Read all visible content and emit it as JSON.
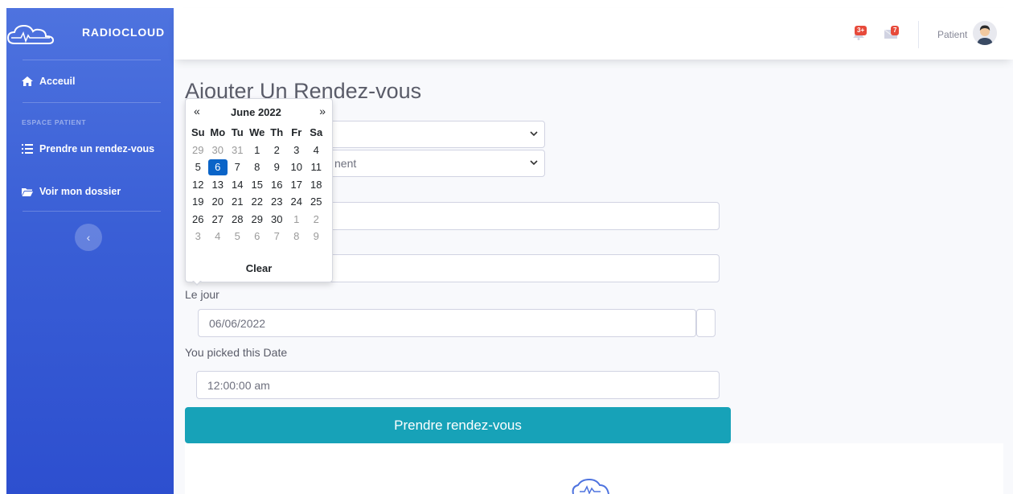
{
  "brand": {
    "name": "RADIOCLOUD",
    "logo_icon": "cloud-heartbeat-icon"
  },
  "sidebar": {
    "items": [
      {
        "label": "Acceuil",
        "icon": "home-icon"
      },
      {
        "label": "Prendre un rendez-vous",
        "icon": "list-icon"
      },
      {
        "label": "Voir mon dossier",
        "icon": "folder-icon"
      }
    ],
    "heading": "ESPACE PATIENT",
    "toggle_icon": "chevron-left-icon"
  },
  "topbar": {
    "alerts_count": "3+",
    "messages_count": "7",
    "user_name": "Patient"
  },
  "page": {
    "title": "Ajouter Un Rendez-vous",
    "select2_partial": "nent",
    "day_label": "Le jour",
    "date_value": "06/06/2022",
    "picked_label": "You picked this Date",
    "time_value": "12:00:00 am",
    "submit_label": "Prendre rendez-vous"
  },
  "datepicker": {
    "prev": "«",
    "next": "»",
    "month": "June 2022",
    "weekdays": [
      "Su",
      "Mo",
      "Tu",
      "We",
      "Th",
      "Fr",
      "Sa"
    ],
    "weeks": [
      [
        "29",
        "30",
        "31",
        "1",
        "2",
        "3",
        "4"
      ],
      [
        "5",
        "6",
        "7",
        "8",
        "9",
        "10",
        "11"
      ],
      [
        "12",
        "13",
        "14",
        "15",
        "16",
        "17",
        "18"
      ],
      [
        "19",
        "20",
        "21",
        "22",
        "23",
        "24",
        "25"
      ],
      [
        "26",
        "27",
        "28",
        "29",
        "30",
        "1",
        "2"
      ],
      [
        "3",
        "4",
        "5",
        "6",
        "7",
        "8",
        "9"
      ]
    ],
    "selected_day": "6",
    "clear_label": "Clear"
  },
  "colors": {
    "sidebar_start": "#4e73df",
    "sidebar_end": "#2d4fcf",
    "button": "#17a2b8",
    "selected_day": "#0a64c8",
    "badge": "#e74a3b"
  }
}
